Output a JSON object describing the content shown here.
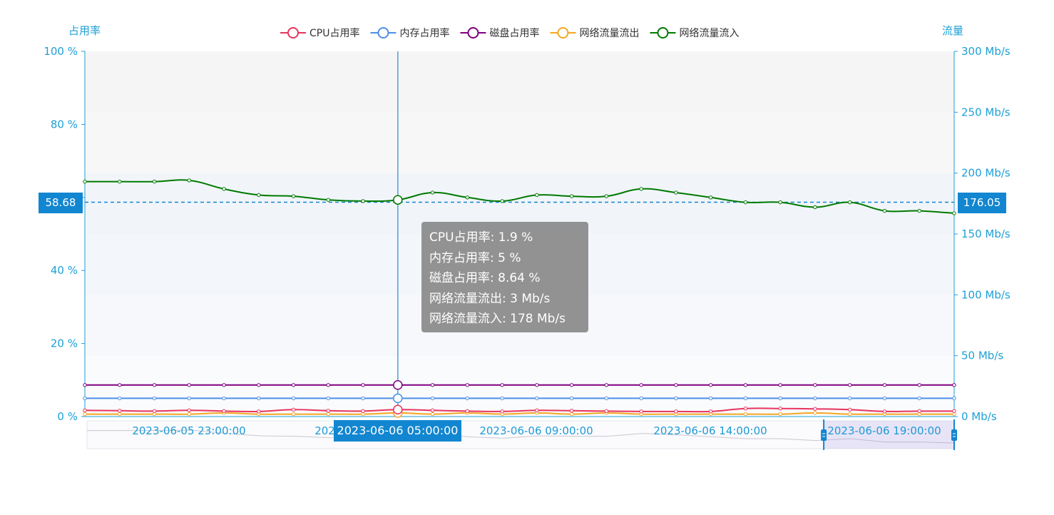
{
  "chart_data": {
    "type": "line",
    "legend_position": "top",
    "y_left": {
      "name": "占用率",
      "min": 0,
      "max": 100,
      "ticks": [
        0,
        20,
        40,
        60,
        80,
        100
      ],
      "unit_suffix": " %"
    },
    "y_right": {
      "name": "流量",
      "min": 0,
      "max": 300,
      "ticks": [
        0,
        50,
        100,
        150,
        200,
        250,
        300
      ],
      "unit_suffix": " Mb/s"
    },
    "x_tick_labels": [
      "2023-06-05 23:00:00",
      "2023-",
      "2023-06-06 09:00:00",
      "2023-06-06 14:00:00",
      "2023-06-06 19:00:00"
    ],
    "point_count": 26,
    "cursor": {
      "index": 9,
      "x_label": "2023-06-06 05:00:00",
      "left_value_label": "58.68",
      "right_value_label": "176.05"
    },
    "tooltip": [
      "CPU占用率: 1.9 %",
      "内存占用率: 5 %",
      "磁盘占用率: 8.64 %",
      "网络流量流出: 3 Mb/s",
      "网络流量流入: 178 Mb/s"
    ],
    "series": [
      {
        "name": "CPU占用率",
        "axis": "left",
        "color": "#e8335f",
        "values": [
          1.7,
          1.6,
          1.5,
          1.7,
          1.5,
          1.4,
          1.9,
          1.6,
          1.5,
          1.9,
          1.7,
          1.5,
          1.4,
          1.7,
          1.6,
          1.5,
          1.4,
          1.4,
          1.4,
          2.2,
          2.2,
          2.1,
          1.9,
          1.4,
          1.5,
          1.5
        ]
      },
      {
        "name": "内存占用率",
        "axis": "left",
        "color": "#4d8fe8",
        "values": [
          5,
          5,
          5,
          5,
          5,
          5,
          5,
          5,
          5,
          5,
          5,
          5,
          5,
          5,
          5,
          5,
          5,
          5,
          5,
          5,
          5,
          5,
          5,
          5,
          5,
          5
        ]
      },
      {
        "name": "磁盘占用率",
        "axis": "left",
        "color": "#800080",
        "values": [
          8.64,
          8.64,
          8.64,
          8.64,
          8.64,
          8.64,
          8.64,
          8.64,
          8.64,
          8.64,
          8.64,
          8.64,
          8.64,
          8.64,
          8.64,
          8.64,
          8.64,
          8.64,
          8.64,
          8.64,
          8.64,
          8.64,
          8.64,
          8.64,
          8.64,
          8.64
        ]
      },
      {
        "name": "网络流量流出",
        "axis": "right",
        "color": "#f5a623",
        "values": [
          2,
          2,
          2,
          2,
          3,
          2,
          2,
          2,
          2,
          3,
          2,
          3,
          2,
          3,
          2,
          3,
          2,
          2,
          2,
          2,
          2,
          3,
          2,
          2,
          2,
          2
        ]
      },
      {
        "name": "网络流量流入",
        "axis": "right",
        "color": "#007a00",
        "values": [
          193,
          193,
          193,
          194,
          187,
          182,
          181,
          178,
          177,
          178,
          184,
          180,
          177,
          182,
          181,
          181,
          187,
          184,
          180,
          176,
          176,
          172,
          176,
          169,
          169,
          167
        ]
      }
    ],
    "datazoom": {
      "start_fraction": 0.85,
      "end_fraction": 1.0
    }
  }
}
